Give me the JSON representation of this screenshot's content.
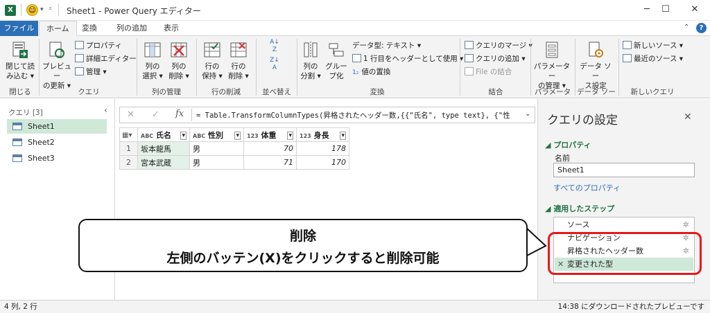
{
  "window": {
    "title": "Sheet1 - Power Query エディター",
    "app_icon": "X",
    "controls": {
      "minimize": "─",
      "maximize": "☐",
      "close": "✕"
    }
  },
  "ribbon_tabs": [
    "ファイル",
    "ホーム",
    "変換",
    "列の追加",
    "表示"
  ],
  "ribbon": {
    "close_group": {
      "btn": [
        "閉じて読",
        "み込む ▾"
      ],
      "label": "閉じる"
    },
    "query_group": {
      "preview": [
        "プレビュー",
        "の更新 ▾"
      ],
      "properties": "プロパティ",
      "advanced_editor": "詳細エディター",
      "manage": "管理 ▾",
      "label": "クエリ"
    },
    "columns_group": {
      "choose": [
        "列の",
        "選択 ▾"
      ],
      "remove": [
        "列の",
        "削除 ▾"
      ],
      "label": "列の管理"
    },
    "rows_group": {
      "keep": [
        "行の",
        "保持 ▾"
      ],
      "remove": [
        "行の",
        "削除 ▾"
      ],
      "label": "行の削減"
    },
    "sort_group": {
      "label": "並べ替え"
    },
    "transform_group": {
      "split": [
        "列の",
        "分割 ▾"
      ],
      "groupby": [
        "グルー",
        "プ化"
      ],
      "datatype": "データ型: テキスト ▾",
      "first_row": "1 行目をヘッダーとして使用 ▾",
      "replace": "値の置換",
      "label": "変換"
    },
    "combine_group": {
      "merge": "クエリのマージ ▾",
      "append": "クエリの追加 ▾",
      "files": "File の結合",
      "label": "結合"
    },
    "params_group": {
      "btn": [
        "パラメーター",
        "の管理 ▾"
      ],
      "label": "パラメーター"
    },
    "datasource_group": {
      "btn": [
        "データ ソー",
        "ス設定"
      ],
      "label": "データ ソース"
    },
    "newquery_group": {
      "new_source": "新しいソース ▾",
      "recent": "最近のソース ▾",
      "label": "新しいクエリ"
    }
  },
  "queries_pane": {
    "header": "クエリ [3]",
    "items": [
      "Sheet1",
      "Sheet2",
      "Sheet3"
    ],
    "selected": 0
  },
  "formula_bar": {
    "formula": "= Table.TransformColumnTypes(昇格されたヘッダー数,{{\"氏名\", type text}, {\"性"
  },
  "grid": {
    "columns": [
      {
        "type": "ABC",
        "name": "氏名"
      },
      {
        "type": "ABC",
        "name": "性別"
      },
      {
        "type": "123",
        "name": "体重"
      },
      {
        "type": "123",
        "name": "身長"
      }
    ],
    "rows": [
      [
        "1",
        "坂本龍馬",
        "男",
        "70",
        "178"
      ],
      [
        "2",
        "宮本武蔵",
        "男",
        "71",
        "170"
      ]
    ]
  },
  "settings_pane": {
    "title": "クエリの設定",
    "properties_header": "プロパティ",
    "name_label": "名前",
    "name_value": "Sheet1",
    "all_properties": "すべてのプロパティ",
    "steps_header": "適用したステップ",
    "steps": [
      "ソース",
      "ナビゲーション",
      "昇格されたヘッダー数",
      "変更された型"
    ]
  },
  "status_bar": {
    "left": "4 列, 2 行",
    "right": "14:38 にダウンロードされたプレビューです"
  },
  "callout": {
    "line1": "削除",
    "line2": "左側のバッテン(X)をクリックすると削除可能"
  },
  "colors": {
    "accent": "#2b6fb6",
    "selected": "#cfe8d8",
    "highlight_red": "#e81818",
    "green": "#217346"
  }
}
